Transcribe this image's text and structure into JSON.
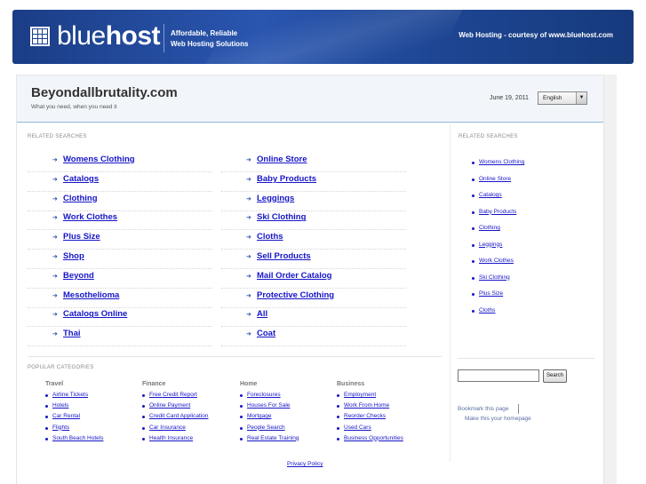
{
  "banner": {
    "brand_light": "blue",
    "brand_bold": "host",
    "tagline_line1": "Affordable, Reliable",
    "tagline_line2": "Web Hosting Solutions",
    "courtesy": "Web Hosting - courtesy of www.bluehost.com"
  },
  "header": {
    "site_title": "Beyondallbrutality.com",
    "site_subtitle": "What you need, when you need it",
    "date": "June 19, 2011",
    "language": "English"
  },
  "related": {
    "label": "RELATED SEARCHES",
    "left": [
      "Womens Clothing",
      "Catalogs",
      "Clothing",
      "Work Clothes",
      "Plus Size",
      "Shop",
      "Beyond",
      "Mesothelioma",
      "Catalogs Online",
      "Thai"
    ],
    "right": [
      "Online Store",
      "Baby Products",
      "Leggings",
      "Ski Clothing",
      "Cloths",
      "Sell Products",
      "Mail Order Catalog",
      "Protective Clothing",
      "All",
      "Coat"
    ]
  },
  "sidebar": {
    "label": "RELATED SEARCHES",
    "items": [
      "Womens Clothing",
      "Online Store",
      "Catalogs",
      "Baby Products",
      "Clothing",
      "Leggings",
      "Work Clothes",
      "Ski Clothing",
      "Plus Size",
      "Cloths"
    ],
    "search_button": "Search",
    "bookmark": "Bookmark this page",
    "homepage": "Make this your homepage"
  },
  "popular": {
    "label": "POPULAR CATEGORIES",
    "columns": [
      {
        "title": "Travel",
        "links": [
          "Airline Tickets",
          "Hotels",
          "Car Rental",
          "Flights",
          "South Beach Hotels"
        ]
      },
      {
        "title": "Finance",
        "links": [
          "Free Credit Report",
          "Online Payment",
          "Credit Card Application",
          "Car Insurance",
          "Health Insurance"
        ]
      },
      {
        "title": "Home",
        "links": [
          "Foreclosures",
          "Houses For Sale",
          "Mortgage",
          "People Search",
          "Real Estate Training"
        ]
      },
      {
        "title": "Business",
        "links": [
          "Employment",
          "Work From Home",
          "Reorder Checks",
          "Used Cars",
          "Business Opportunities"
        ]
      }
    ]
  },
  "footer": {
    "privacy": "Privacy Policy"
  },
  "colors": {
    "banner": "#1d4592",
    "link": "#1515c8",
    "header_band": "#f2f6fa"
  }
}
